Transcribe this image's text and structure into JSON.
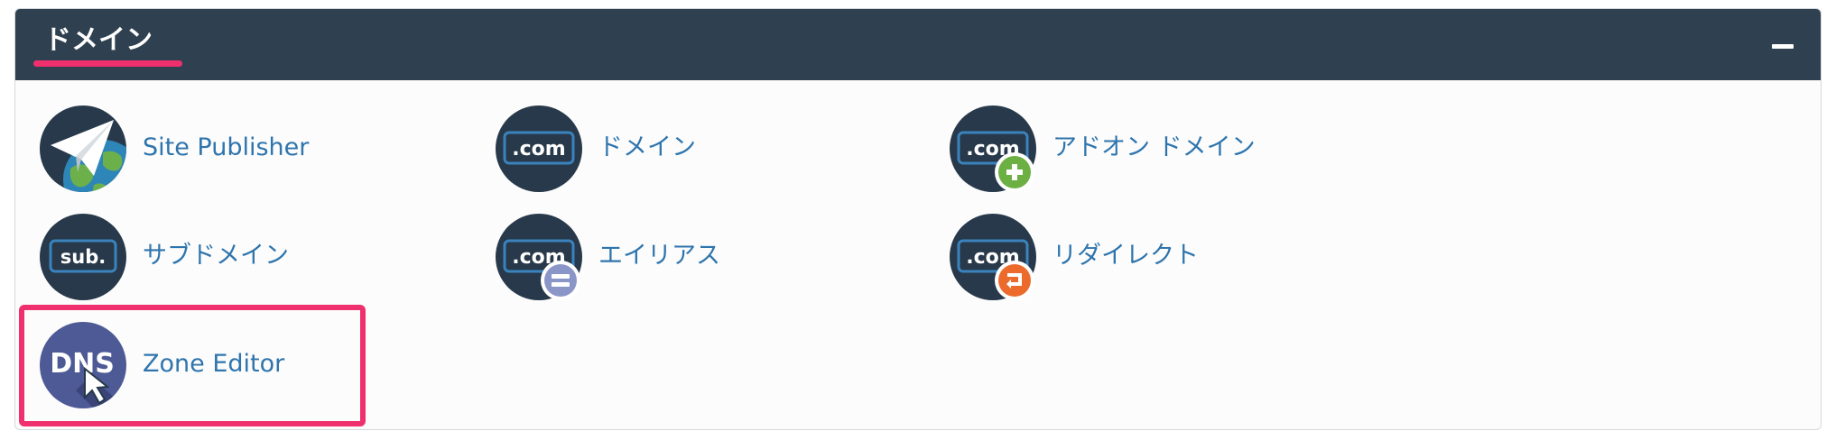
{
  "section": {
    "title": "ドメイン",
    "collapse_icon": "minus-icon"
  },
  "colors": {
    "header_bg": "#2f4150",
    "accent": "#f0306e",
    "link": "#2f75ad"
  },
  "items": [
    {
      "label": "Site Publisher",
      "icon": "paper-plane-globe-icon"
    },
    {
      "label": "ドメイン",
      "icon": "dotcom-icon"
    },
    {
      "label": "アドオン ドメイン",
      "icon": "dotcom-plus-icon"
    },
    {
      "label": "サブドメイン",
      "icon": "sub-domain-icon"
    },
    {
      "label": "エイリアス",
      "icon": "dotcom-equals-icon"
    },
    {
      "label": "リダイレクト",
      "icon": "dotcom-redirect-icon"
    },
    {
      "label": "Zone Editor",
      "icon": "dns-zone-editor-icon"
    }
  ]
}
